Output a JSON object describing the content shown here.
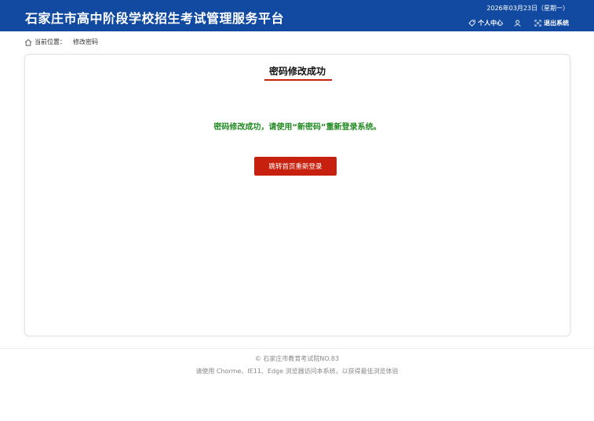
{
  "header": {
    "title": "石家庄市高中阶段学校招生考试管理服务平台",
    "date": "2026年03月23日（星期一）",
    "personal_center": "个人中心",
    "logout": "退出系统"
  },
  "breadcrumb": {
    "label": "当前位置：",
    "current": "修改密码"
  },
  "card": {
    "title": "密码修改成功",
    "message": "密码修改成功，请使用“新密码”重新登录系统。",
    "button": "跳转首页重新登录"
  },
  "footer": {
    "copyright": "© 石家庄市教育考试院NO.83",
    "browser_note": "请使用 Chorme、IE11、Edge 浏览器访问本系统，以获得最佳浏览体验"
  },
  "colors": {
    "header_bg": "#114aa0",
    "accent_red": "#c8200e",
    "success_green": "#228b22"
  }
}
